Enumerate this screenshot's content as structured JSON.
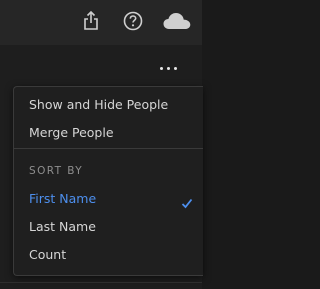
{
  "menu": {
    "items": [
      {
        "label": "Show and Hide People"
      },
      {
        "label": "Merge People"
      }
    ],
    "sort_by_label": "SORT BY",
    "sort_options": [
      {
        "label": "First Name",
        "selected": true
      },
      {
        "label": "Last Name",
        "selected": false
      },
      {
        "label": "Count",
        "selected": false
      }
    ]
  },
  "icons": {
    "share": "share-icon",
    "help": "help-icon",
    "cloud": "cloud-icon",
    "more": "more-horizontal-icon",
    "check": "checkmark-icon"
  },
  "colors": {
    "accent": "#4d8fee",
    "menu_text": "#d6d6d6",
    "section_label": "#8e8e8e"
  }
}
